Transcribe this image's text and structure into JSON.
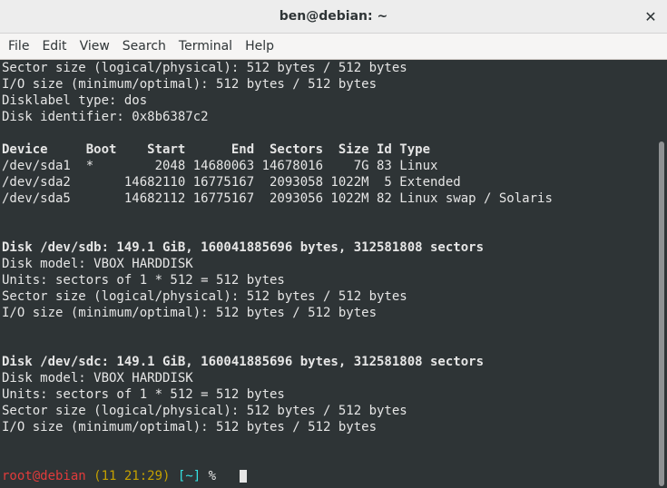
{
  "window": {
    "title": "ben@debian: ~",
    "close_glyph": "✕"
  },
  "menu": [
    "File",
    "Edit",
    "View",
    "Search",
    "Terminal",
    "Help"
  ],
  "terminal": {
    "lines": [
      {
        "text": "Sector size (logical/physical): 512 bytes / 512 bytes",
        "bold": false
      },
      {
        "text": "I/O size (minimum/optimal): 512 bytes / 512 bytes",
        "bold": false
      },
      {
        "text": "Disklabel type: dos",
        "bold": false
      },
      {
        "text": "Disk identifier: 0x8b6387c2",
        "bold": false
      },
      {
        "text": "",
        "bold": false
      },
      {
        "text": "Device     Boot    Start      End  Sectors  Size Id Type",
        "bold": true
      },
      {
        "text": "/dev/sda1  *        2048 14680063 14678016    7G 83 Linux",
        "bold": false
      },
      {
        "text": "/dev/sda2       14682110 16775167  2093058 1022M  5 Extended",
        "bold": false
      },
      {
        "text": "/dev/sda5       14682112 16775167  2093056 1022M 82 Linux swap / Solaris",
        "bold": false
      },
      {
        "text": "",
        "bold": false
      },
      {
        "text": "",
        "bold": false
      },
      {
        "text": "Disk /dev/sdb: 149.1 GiB, 160041885696 bytes, 312581808 sectors",
        "bold": true
      },
      {
        "text": "Disk model: VBOX HARDDISK",
        "bold": false
      },
      {
        "text": "Units: sectors of 1 * 512 = 512 bytes",
        "bold": false
      },
      {
        "text": "Sector size (logical/physical): 512 bytes / 512 bytes",
        "bold": false
      },
      {
        "text": "I/O size (minimum/optimal): 512 bytes / 512 bytes",
        "bold": false
      },
      {
        "text": "",
        "bold": false
      },
      {
        "text": "",
        "bold": false
      },
      {
        "text": "Disk /dev/sdc: 149.1 GiB, 160041885696 bytes, 312581808 sectors",
        "bold": true
      },
      {
        "text": "Disk model: VBOX HARDDISK",
        "bold": false
      },
      {
        "text": "Units: sectors of 1 * 512 = 512 bytes",
        "bold": false
      },
      {
        "text": "Sector size (logical/physical): 512 bytes / 512 bytes",
        "bold": false
      },
      {
        "text": "I/O size (minimum/optimal): 512 bytes / 512 bytes",
        "bold": false
      }
    ],
    "prompt": {
      "user_host": "root@debian",
      "time": "(11 21:29)",
      "cwd": "[~]",
      "symbol": "%"
    }
  },
  "colors": {
    "background": "#2e3436",
    "text": "#e6e6e6",
    "prompt_user": "#e13b3b",
    "prompt_time": "#c4a000",
    "prompt_cwd": "#34e2e2"
  }
}
